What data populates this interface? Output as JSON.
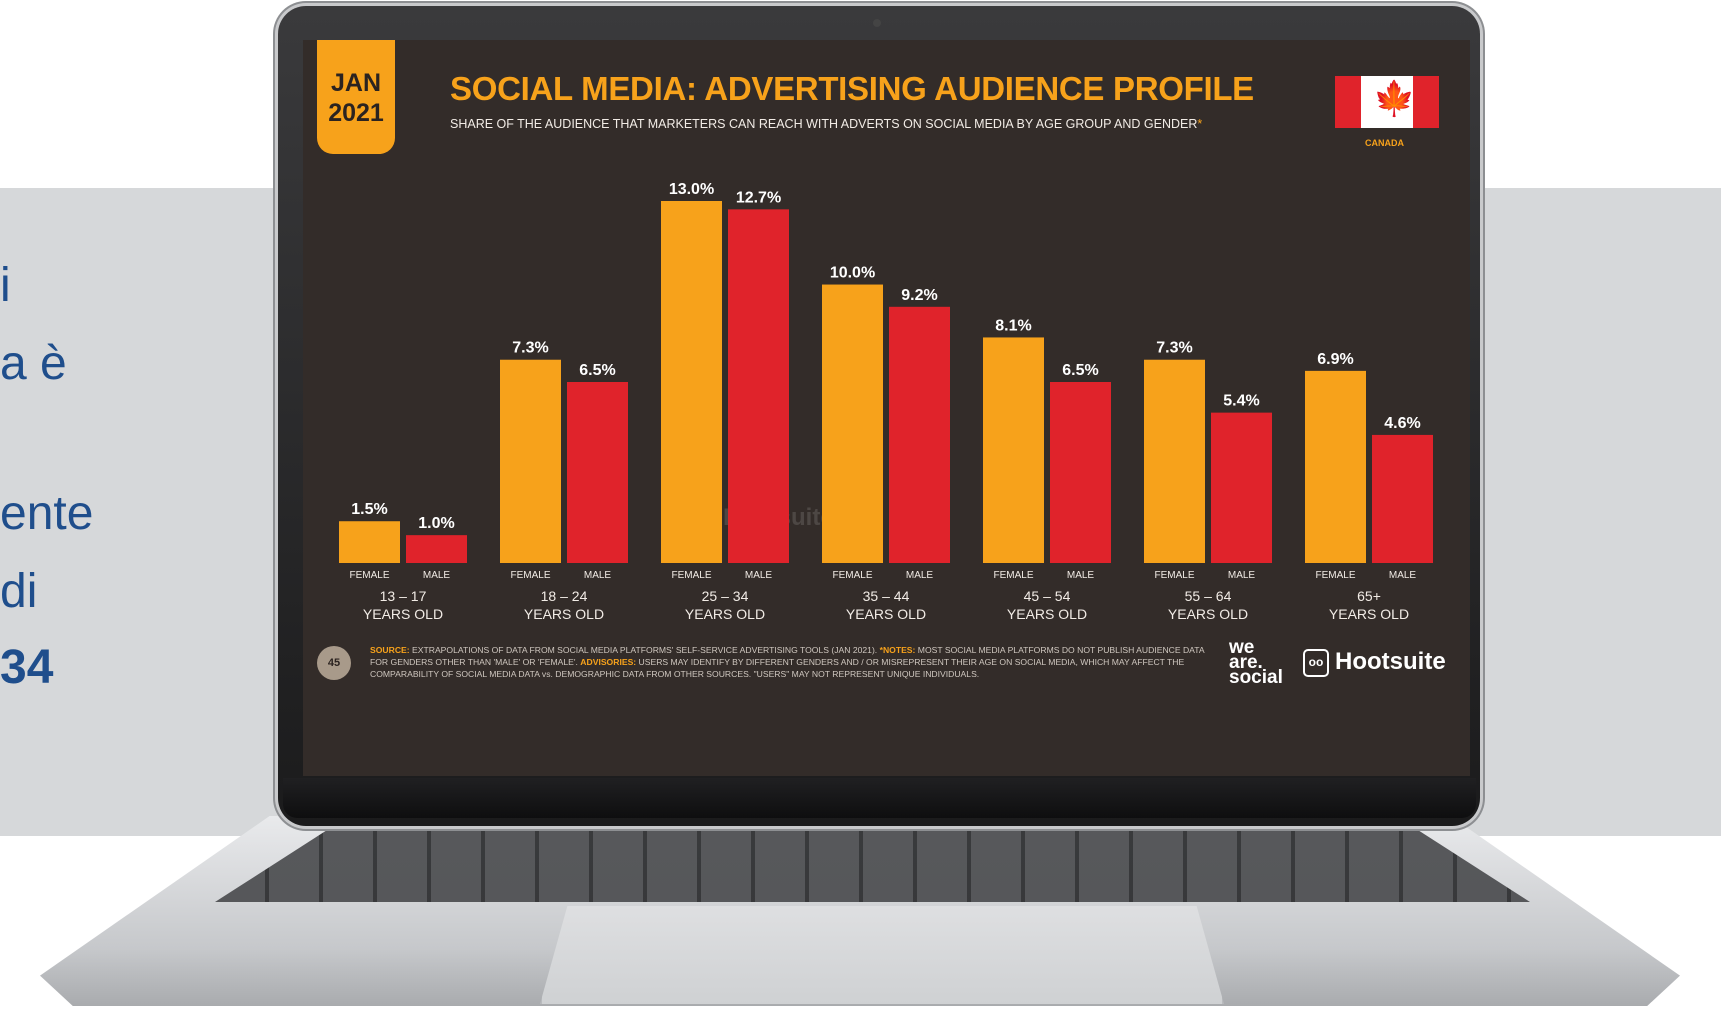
{
  "side_text": {
    "lines": [
      "i",
      "a è",
      "",
      "ente",
      "di",
      "34"
    ]
  },
  "slide": {
    "date_month": "JAN",
    "date_year": "2021",
    "title": "SOCIAL MEDIA: ADVERTISING AUDIENCE PROFILE",
    "subtitle": "SHARE OF THE AUDIENCE THAT MARKETERS CAN REACH WITH ADVERTS ON SOCIAL MEDIA BY AGE GROUP AND GENDER",
    "subtitle_mark": "*",
    "country": "CANADA",
    "page_number": "45",
    "footnote": {
      "source_label": "SOURCE:",
      "source_text": " EXTRAPOLATIONS OF DATA FROM SOCIAL MEDIA PLATFORMS' SELF-SERVICE ADVERTISING TOOLS (JAN 2021). ",
      "notes_label": "*NOTES:",
      "notes_text": " MOST SOCIAL MEDIA PLATFORMS DO NOT PUBLISH AUDIENCE DATA FOR GENDERS OTHER THAN 'MALE' OR 'FEMALE'. ",
      "advisories_label": "ADVISORIES:",
      "advisories_text": " USERS MAY IDENTIFY BY DIFFERENT GENDERS AND / OR MISREPRESENT THEIR AGE ON SOCIAL MEDIA, WHICH MAY AFFECT THE COMPARABILITY OF SOCIAL MEDIA DATA vs. DEMOGRAPHIC DATA FROM OTHER SOURCES. \"USERS\" MAY NOT REPRESENT UNIQUE INDIVIDUALS."
    },
    "brand_we": [
      "we",
      "are.",
      "social"
    ],
    "brand_hootsuite": "Hootsuite",
    "watermark": "Hootsuite"
  },
  "chart_data": {
    "type": "bar",
    "title": "SOCIAL MEDIA: ADVERTISING AUDIENCE PROFILE",
    "categories": [
      "13 – 17",
      "18 – 24",
      "25 – 34",
      "35 – 44",
      "45 – 54",
      "55 – 64",
      "65+"
    ],
    "category_sublabel": "YEARS OLD",
    "bar_labels": [
      "FEMALE",
      "MALE"
    ],
    "series": [
      {
        "values": [
          1.5,
          7.3,
          13.0,
          10.0,
          8.1,
          7.3,
          6.9
        ],
        "labels": [
          "1.5%",
          "7.3%",
          "13.0%",
          "10.0%",
          "8.1%",
          "7.3%",
          "6.9%"
        ]
      },
      {
        "values": [
          1.0,
          6.5,
          12.7,
          9.2,
          6.5,
          5.4,
          4.6
        ],
        "labels": [
          "1.0%",
          "6.5%",
          "12.7%",
          "9.2%",
          "6.5%",
          "5.4%",
          "4.6%"
        ]
      }
    ],
    "ylim": [
      0,
      13.0
    ],
    "grid": false,
    "colors": {
      "female": "#f7a21b",
      "male": "#e0232b",
      "background": "#332c29"
    }
  }
}
